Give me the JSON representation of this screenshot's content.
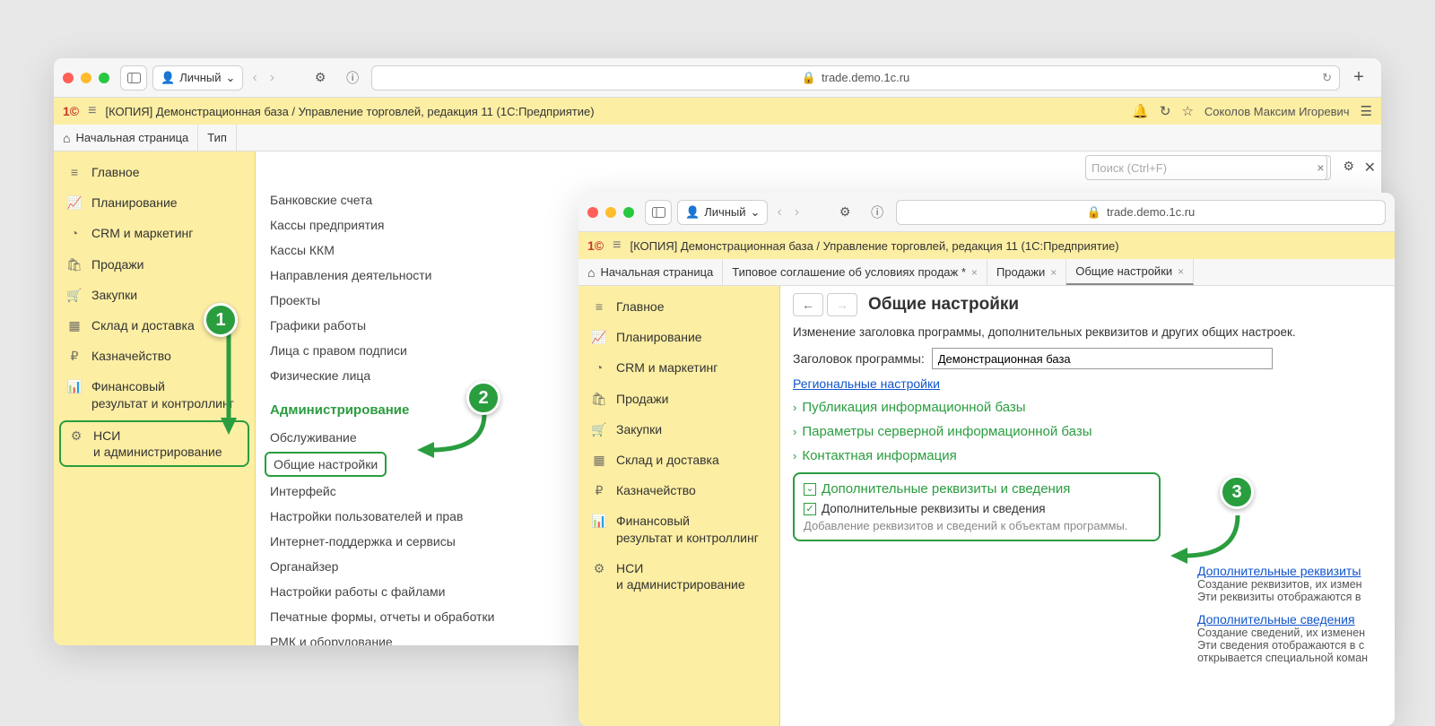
{
  "browser": {
    "profile": "Личный",
    "url": "trade.demo.1c.ru"
  },
  "app": {
    "title": "[КОПИЯ] Демонстрационная база / Управление торговлей, редакция 11  (1С:Предприятие)",
    "user": "Соколов Максим Игоревич"
  },
  "tabs1": {
    "home": "Начальная страница",
    "second": "Тип"
  },
  "sidebar": [
    "Главное",
    "Планирование",
    "CRM и маркетинг",
    "Продажи",
    "Закупки",
    "Склад и доставка",
    "Казначейство",
    "Финансовый\nрезультат и контроллинг",
    "НСИ\nи администрирование"
  ],
  "panel1": {
    "search_placeholder": "Поиск (Ctrl+F)",
    "top_items": [
      "Банковские счета",
      "Кассы предприятия",
      "Кассы ККМ",
      "Направления деятельности",
      "Проекты",
      "Графики работы",
      "Лица с правом подписи",
      "Физические лица"
    ],
    "section": "Администрирование",
    "admin_items": [
      "Обслуживание",
      "Общие настройки",
      "Интерфейс",
      "Настройки пользователей и прав",
      "Интернет-поддержка и сервисы",
      "Органайзер",
      "Настройки работы с файлами",
      "Печатные формы, отчеты и обработки",
      "РМК и оборудование"
    ]
  },
  "tabs2": {
    "home": "Начальная страница",
    "t1": "Типовое соглашение об условиях продаж *",
    "t2": "Продажи",
    "t3": "Общие настройки"
  },
  "content2": {
    "title": "Общие настройки",
    "desc": "Изменение заголовка программы, дополнительных реквизитов и других общих настроек.",
    "field_label": "Заголовок программы:",
    "field_value": "Демонстрационная база",
    "regional": "Региональные настройки",
    "groups": [
      "Публикация информационной базы",
      "Параметры серверной информационной базы",
      "Контактная информация"
    ],
    "hl": {
      "title": "Дополнительные реквизиты и сведения",
      "cb_label": "Дополнительные реквизиты и сведения",
      "hint": "Добавление реквизитов и сведений к объектам программы."
    },
    "side": {
      "l1": "Дополнительные реквизиты",
      "d1a": "Создание реквизитов, их измен",
      "d1b": "Эти реквизиты отображаются в",
      "l2": "Дополнительные сведения",
      "d2a": "Создание сведений, их изменен",
      "d2b": "Эти сведения отображаются в с",
      "d2c": "открывается специальной коман"
    }
  },
  "badges": {
    "b1": "1",
    "b2": "2",
    "b3": "3"
  }
}
